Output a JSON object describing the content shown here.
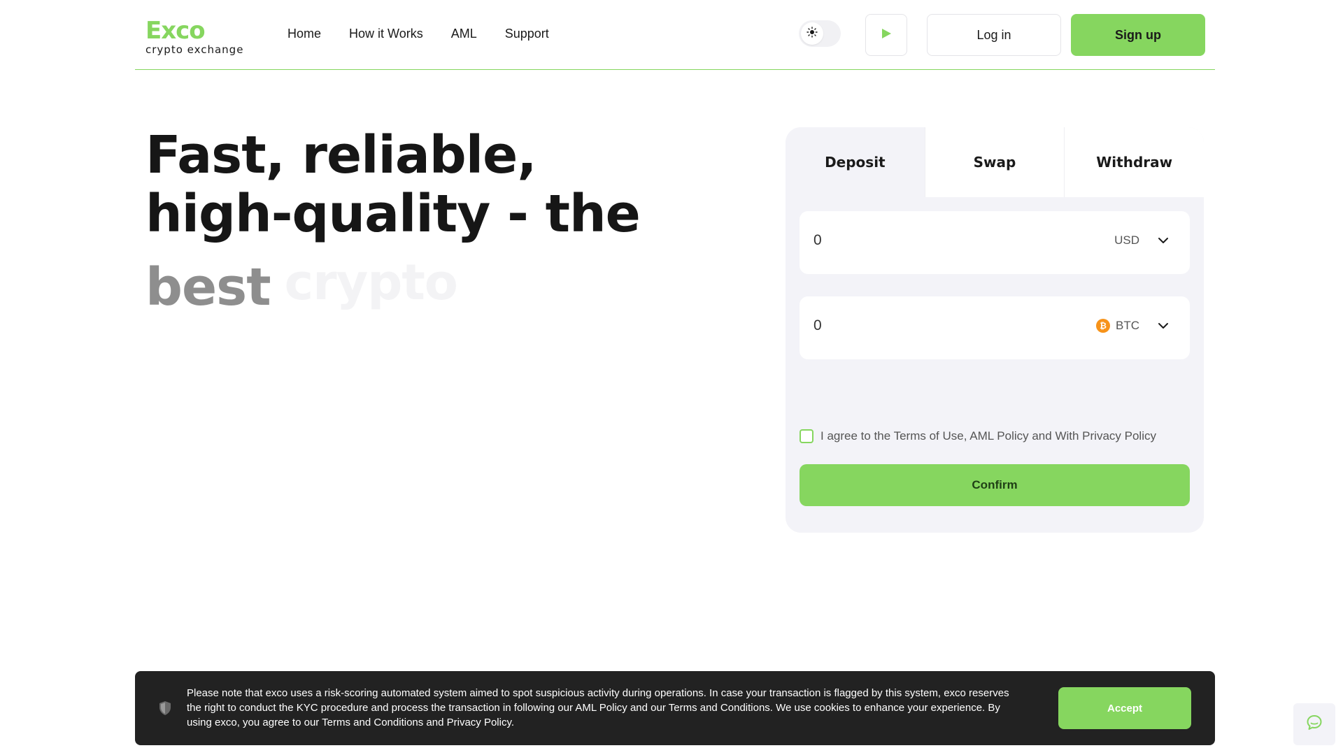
{
  "header": {
    "logo_word": "Exco",
    "logo_sub": "crypto exchange",
    "nav": [
      {
        "label": "Home"
      },
      {
        "label": "How it Works"
      },
      {
        "label": "AML"
      },
      {
        "label": "Support"
      }
    ],
    "login_label": "Log in",
    "signup_label": "Sign up",
    "theme_icon": "sun-icon",
    "play_icon": "play-icon"
  },
  "hero": {
    "line1": "Fast, reliable,",
    "line2": "high-quality - the",
    "line3_word": "best",
    "line3_faded": "crypto"
  },
  "exchange": {
    "tabs": [
      {
        "label": "Deposit",
        "active": true
      },
      {
        "label": "Swap",
        "active": false
      },
      {
        "label": "Withdraw",
        "active": false
      }
    ],
    "from": {
      "value": "0",
      "currency": "USD"
    },
    "to": {
      "value": "0",
      "currency": "BTC",
      "currency_icon": "btc-icon"
    },
    "agree_text": "I agree to the Terms of Use, AML Policy and With Privacy Policy",
    "confirm_label": "Confirm"
  },
  "notice": {
    "text": "Please note that exco uses a risk-scoring automated system aimed to spot suspicious activity during operations. In case your transaction is flagged by this system, exco reserves the right to conduct the KYC procedure and process the transaction in following our AML Policy and our Terms and Conditions. We use cookies to enhance your experience. By using exco, you agree to our Terms and Conditions and Privacy Policy.",
    "accept_label": "Accept"
  },
  "colors": {
    "accent": "#86d65f",
    "dark": "#222222",
    "card_bg": "#f3f3f8",
    "btc": "#f7931a"
  }
}
